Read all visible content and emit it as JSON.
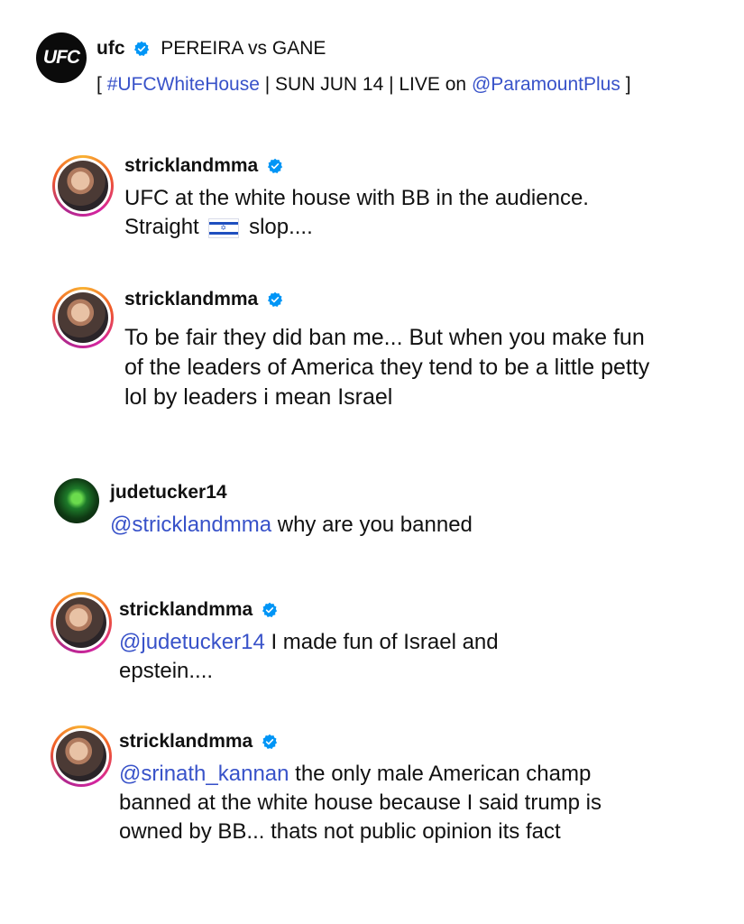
{
  "post": {
    "username": "ufc",
    "title": "PEREIRA vs GANE",
    "caption_open": "[",
    "caption_hashtag": "#UFCWhiteHouse",
    "caption_middle": "| SUN JUN 14 | LIVE on",
    "caption_mention": "@ParamountPlus",
    "caption_close": "]",
    "logo_text": "UFC"
  },
  "comments": [
    {
      "username": "stricklandmma",
      "text_before_flag": "UFC at the white house with BB in the audience.",
      "text_line2_start": "Straight",
      "flag_icon": "israel-flag-icon",
      "text_after_flag": "slop...."
    },
    {
      "username": "stricklandmma",
      "text": "To be fair they did ban me... But when you make fun of the leaders of America they tend to be a little petty lol by leaders i mean Israel"
    },
    {
      "username": "judetucker14",
      "mention": "@stricklandmma",
      "text": "why are you banned"
    },
    {
      "username": "stricklandmma",
      "mention": "@judetucker14",
      "text": "I made fun of Israel and epstein...."
    },
    {
      "username": "stricklandmma",
      "mention": "@srinath_kannan",
      "text": "the only male American champ banned at the white house because I said trump is owned by BB... thats not public opinion its fact"
    }
  ],
  "colors": {
    "link": "#3852c9",
    "verified": "#0095f6",
    "text": "#111111"
  }
}
